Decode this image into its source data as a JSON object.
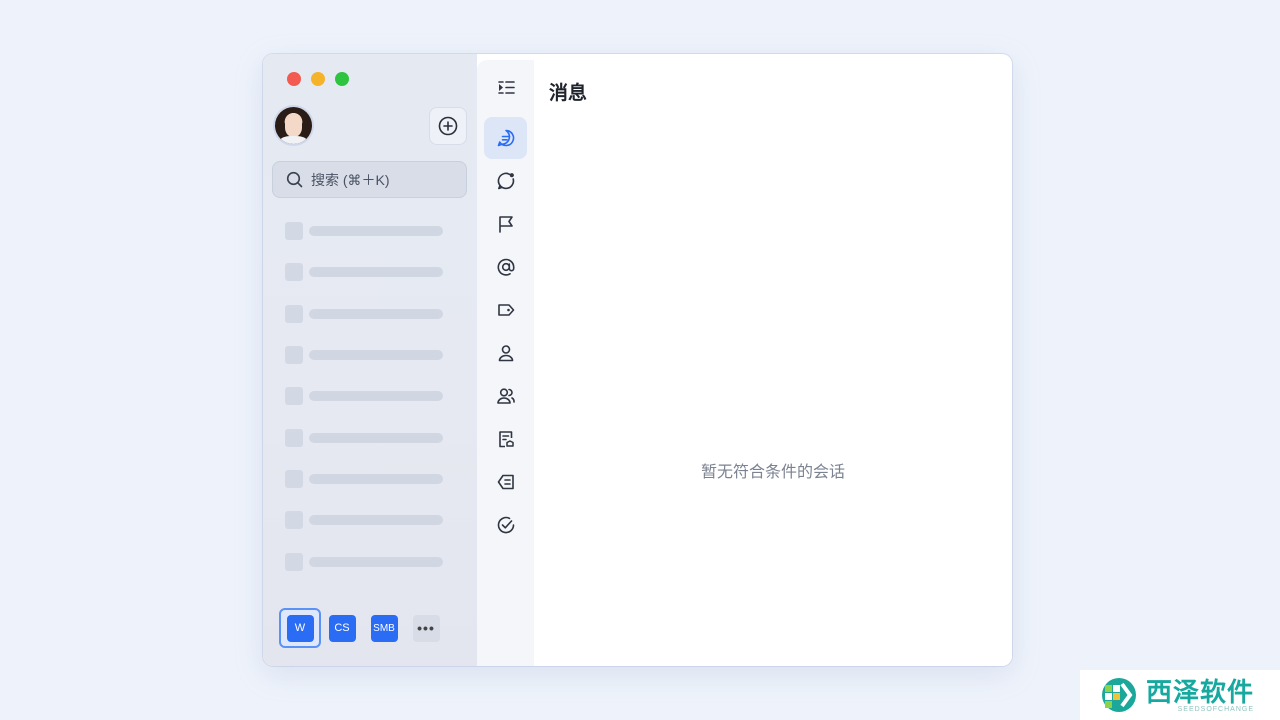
{
  "window": {
    "traffic_colors": [
      "#f25a52",
      "#f5b32a",
      "#2ec440"
    ]
  },
  "sidebar": {
    "search_placeholder": "搜索 (⌘＋K)",
    "skeleton_count": 9,
    "workspaces": [
      {
        "label": "W",
        "active": true
      },
      {
        "label": "CS",
        "active": false
      },
      {
        "label": "SMB",
        "active": false
      },
      {
        "label": "•••",
        "active": false
      }
    ]
  },
  "rail": {
    "items": [
      {
        "icon": "collapse-sidebar-icon"
      },
      {
        "icon": "message-icon",
        "active": true
      },
      {
        "icon": "unread-icon"
      },
      {
        "icon": "flag-icon"
      },
      {
        "icon": "at-mention-icon"
      },
      {
        "icon": "tag-icon"
      },
      {
        "icon": "contact-icon"
      },
      {
        "icon": "group-icon"
      },
      {
        "icon": "document-icon"
      },
      {
        "icon": "bot-icon"
      },
      {
        "icon": "done-icon"
      }
    ]
  },
  "main": {
    "title": "消息",
    "empty_text": "暂无符合条件的会话"
  },
  "watermark": {
    "cn": "西泽软件",
    "en": "SEEDSOFCHANGE"
  },
  "colors": {
    "accent": "#2b6cf5",
    "rail_active": "#dde6f7"
  }
}
